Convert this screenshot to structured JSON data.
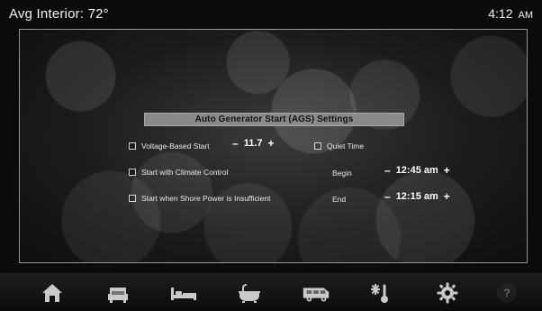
{
  "header": {
    "avg_interior": "Avg Interior: 72°",
    "time": "4:12",
    "ampm": "AM"
  },
  "ags": {
    "title": "Auto Generator Start (AGS) Settings",
    "voltage_label": "Voltage-Based Start",
    "voltage_value": "11.7",
    "climate_label": "Start with Climate Control",
    "shore_label": "Start when Shore Power is Insufficient",
    "quiet_label": "Quiet Time",
    "begin_label": "Begin",
    "begin_value": "12:45 am",
    "end_label": "End",
    "end_value": "12:15 am",
    "minus": "–",
    "plus": "+"
  },
  "nav": {
    "icons": [
      "home-icon",
      "sofa-icon",
      "bed-icon",
      "bathtub-icon",
      "rv-icon",
      "climate-icon",
      "settings-gear-icon",
      "help-icon"
    ],
    "help_text": "?"
  },
  "colors": {
    "accent_gray": "#8a8a8a",
    "nav_icon": "#c9c9c9"
  }
}
